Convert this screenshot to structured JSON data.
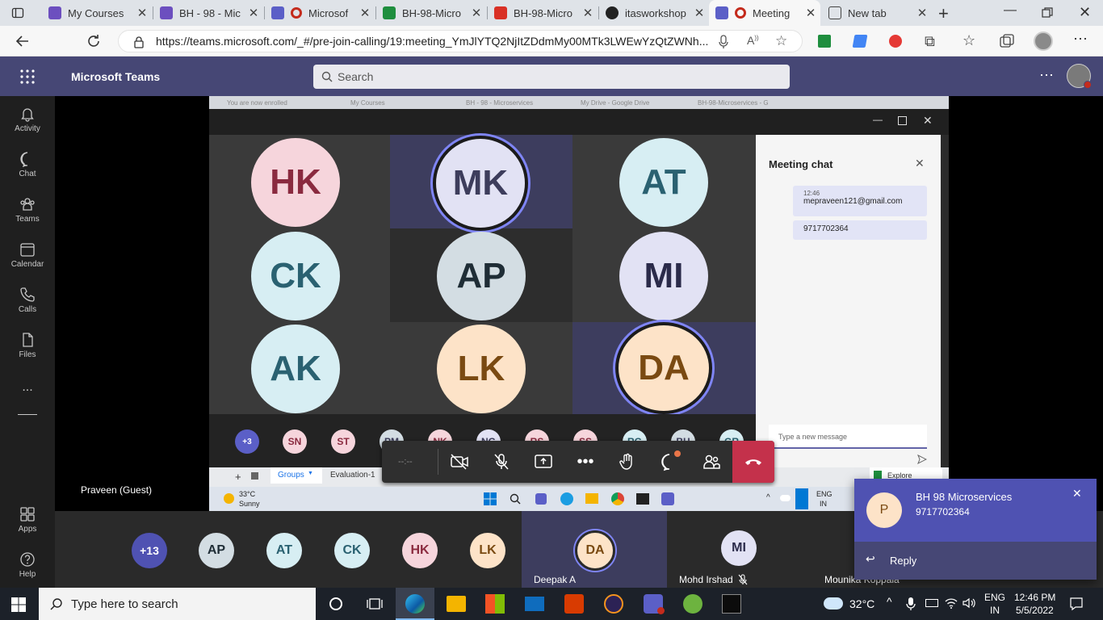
{
  "browser": {
    "tabs": [
      {
        "title": "My Courses",
        "color": "#6c4fbf"
      },
      {
        "title": "BH - 98 - Mic",
        "color": "#6c4fbf"
      },
      {
        "title": "Microsof",
        "color": "#5b5fc7"
      },
      {
        "title": "BH-98-Micro",
        "color": "#1e8e3e"
      },
      {
        "title": "BH-98-Micro",
        "color": "#d93025"
      },
      {
        "title": "itasworkshop",
        "color": "#222222"
      },
      {
        "title": "Meeting",
        "color": "#5b5fc7"
      },
      {
        "title": "New tab",
        "color": "#444444"
      }
    ],
    "url": "https://teams.microsoft.com/_#/pre-join-calling/19:meeting_YmJlYTQ2NjItZDdmMy00MTk3LWEwYzQtZWNh..."
  },
  "teams": {
    "app_name": "Microsoft Teams",
    "search_placeholder": "Search",
    "rail": [
      {
        "label": "Activity",
        "icon": "bell-icon"
      },
      {
        "label": "Chat",
        "icon": "chat-icon"
      },
      {
        "label": "Teams",
        "icon": "teams-icon"
      },
      {
        "label": "Calendar",
        "icon": "calendar-icon"
      },
      {
        "label": "Calls",
        "icon": "phone-icon"
      },
      {
        "label": "Files",
        "icon": "file-icon"
      }
    ],
    "rail_more": "...",
    "rail_bottom": [
      {
        "label": "Apps",
        "icon": "apps-icon"
      },
      {
        "label": "Help",
        "icon": "help-icon"
      }
    ]
  },
  "shared_screen": {
    "inner_tabs": [
      "You are now enrolled",
      "My Courses",
      "BH - 98 - Microservices",
      "My Drive - Google Drive",
      "BH-98-Microservices - G"
    ],
    "grid": [
      {
        "initials": "HK",
        "bg": "#f6d5dc",
        "fg": "#8a2a3f"
      },
      {
        "initials": "MK",
        "bg": "#e2e2f4",
        "fg": "#3d3d5c",
        "speaking": true
      },
      {
        "initials": "AT",
        "bg": "#d7eef3",
        "fg": "#2a6171"
      },
      {
        "initials": "CK",
        "bg": "#d7eef3",
        "fg": "#2a6171"
      },
      {
        "initials": "AP",
        "bg": "#d3dde3",
        "fg": "#1f2d36"
      },
      {
        "initials": "MI",
        "bg": "#e2e2f4",
        "fg": "#2b2b4a"
      },
      {
        "initials": "AK",
        "bg": "#d7eef3",
        "fg": "#2a6171"
      },
      {
        "initials": "LK",
        "bg": "#fde3c8",
        "fg": "#7a4a12"
      },
      {
        "initials": "DA",
        "bg": "#fde3c8",
        "fg": "#7a4a12",
        "speaking": true
      }
    ],
    "mini_row": [
      {
        "initials": "+3",
        "bg": "#5b5fc7",
        "fg": "#ffffff"
      },
      {
        "initials": "SN",
        "bg": "#f6d5dc",
        "fg": "#8a2a3f"
      },
      {
        "initials": "ST",
        "bg": "#f6d5dc",
        "fg": "#8a2a3f"
      },
      {
        "initials": "PM",
        "bg": "#d3dde3",
        "fg": "#3d3d5c"
      },
      {
        "initials": "NK",
        "bg": "#f6d5dc",
        "fg": "#8a2a3f"
      },
      {
        "initials": "NG",
        "bg": "#e2e2f4",
        "fg": "#3d3d5c"
      },
      {
        "initials": "RS",
        "bg": "#f6d5dc",
        "fg": "#8a2a3f"
      },
      {
        "initials": "SS",
        "bg": "#f6d5dc",
        "fg": "#8a2a3f"
      },
      {
        "initials": "RG",
        "bg": "#d7eef3",
        "fg": "#2a6171"
      },
      {
        "initials": "BH",
        "bg": "#d3dde3",
        "fg": "#3d3d5c"
      },
      {
        "initials": "GR",
        "bg": "#d7eef3",
        "fg": "#2a6171"
      }
    ],
    "chat": {
      "title": "Meeting chat",
      "messages": [
        {
          "time": "12:46",
          "text": "mepraveen121@gmail.com"
        },
        {
          "time": "",
          "text": "9717702364"
        }
      ],
      "input_placeholder": "Type a new message"
    },
    "sheet_tabs": [
      "Groups",
      "Evaluation-1"
    ],
    "explore": "Explore",
    "weather_temp": "33°C",
    "weather_desc": "Sunny",
    "lang": "ENG",
    "region": "IN"
  },
  "self_label": "Praveen (Guest)",
  "participants": [
    {
      "initials": "+13",
      "bg": "#4f52b2",
      "fg": "#ffffff"
    },
    {
      "initials": "AP",
      "bg": "#d3dde3",
      "fg": "#1f2d36"
    },
    {
      "initials": "AT",
      "bg": "#d7eef3",
      "fg": "#2a6171"
    },
    {
      "initials": "CK",
      "bg": "#d7eef3",
      "fg": "#2a6171"
    },
    {
      "initials": "HK",
      "bg": "#f6d5dc",
      "fg": "#8a2a3f"
    },
    {
      "initials": "LK",
      "bg": "#fde3c8",
      "fg": "#7a4a12"
    }
  ],
  "strip_tiles": [
    {
      "initials": "DA",
      "name": "Deepak A",
      "bg": "#fde3c8",
      "fg": "#7a4a12",
      "muted": false
    },
    {
      "initials": "MI",
      "name": "Mohd Irshad",
      "bg": "#e2e2f4",
      "fg": "#2b2b4a",
      "muted": true
    },
    {
      "initials": "",
      "name": "Mounika Koppala",
      "bg": "",
      "fg": "",
      "muted": false
    }
  ],
  "toast": {
    "avatar": "P",
    "title": "BH 98 Microservices",
    "body": "9717702364",
    "reply": "Reply"
  },
  "taskbar": {
    "search_placeholder": "Type here to search",
    "weather": "32°C",
    "lang": "ENG",
    "region": "IN",
    "time": "12:46 PM",
    "date": "5/5/2022"
  }
}
